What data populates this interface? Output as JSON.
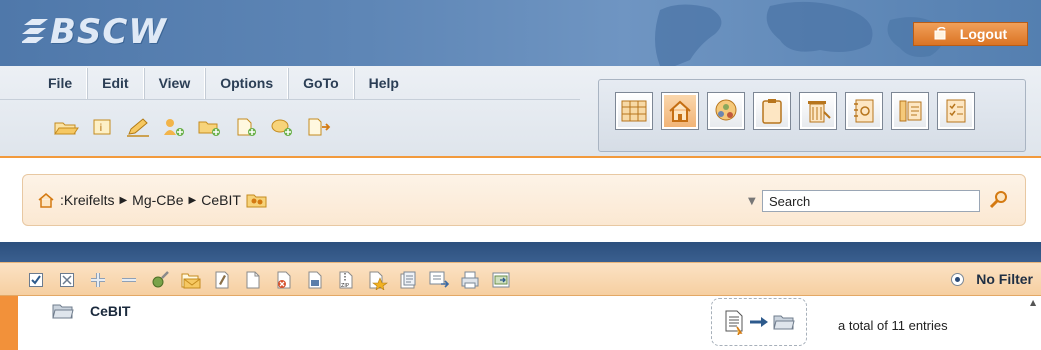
{
  "header": {
    "logo_text": "BSCW",
    "logout_label": "Logout"
  },
  "menu": {
    "items": [
      {
        "label": "File"
      },
      {
        "label": "Edit"
      },
      {
        "label": "View"
      },
      {
        "label": "Options"
      },
      {
        "label": "GoTo"
      },
      {
        "label": "Help"
      }
    ]
  },
  "toolbar": {
    "tools": [
      "open-folder-icon",
      "info-icon",
      "edit-pencil-icon",
      "add-member-icon",
      "new-folder-icon",
      "new-document-icon",
      "add-discussion-icon",
      "export-icon"
    ]
  },
  "nav": {
    "icons": [
      "workspace-grid-icon",
      "home-icon",
      "community-icon",
      "clipboard-icon",
      "waste-bin-icon",
      "address-book-icon",
      "calendar-icon",
      "task-list-icon"
    ],
    "active": "home-icon"
  },
  "breadcrumb": {
    "items": [
      ":Kreifelts",
      "Mg-CBe",
      "CeBIT"
    ]
  },
  "search": {
    "value": "Search"
  },
  "actions": {
    "icons": [
      "select-all-icon",
      "deselect-icon",
      "expand-icon",
      "collapse-icon",
      "tools-icon",
      "send-email-icon",
      "attach-icon",
      "copy-icon",
      "delete-icon",
      "archive-icon",
      "zip-icon",
      "rate-icon",
      "properties-icon",
      "message-icon",
      "print-icon",
      "export-icon"
    ]
  },
  "filter": {
    "label": "No Filter"
  },
  "content": {
    "folder_name": "CeBIT",
    "total_entries": "a total of 11 entries"
  },
  "colors": {
    "accent": "#f29a3c",
    "header_blue": "#5e86b6",
    "dark_band": "#2c4f7d"
  }
}
